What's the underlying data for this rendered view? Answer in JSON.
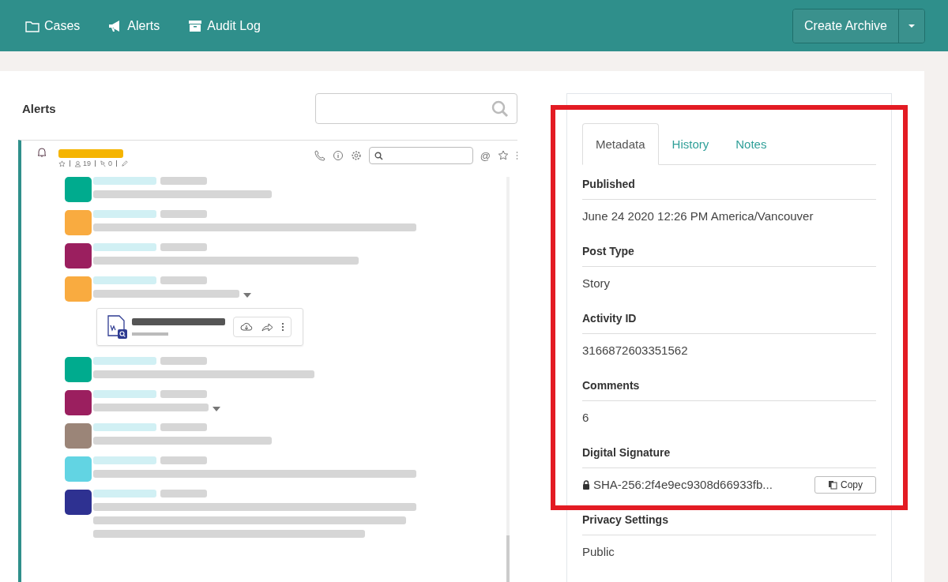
{
  "nav": {
    "items": [
      {
        "label": "Cases"
      },
      {
        "label": "Alerts"
      },
      {
        "label": "Audit Log"
      }
    ],
    "action": "Create Archive"
  },
  "alerts": {
    "title": "Alerts",
    "feed": {
      "members": "19",
      "pins": "0",
      "mention": "@",
      "messages": [
        {
          "color": "#00ab8e",
          "kind": "plain"
        },
        {
          "color": "#f9ab40",
          "kind": "plain"
        },
        {
          "color": "#9b1f5f",
          "kind": "plain"
        },
        {
          "color": "#f9ab40",
          "kind": "attachment"
        },
        {
          "color": "#00ab8e",
          "kind": "plain"
        },
        {
          "color": "#9b1f5f",
          "kind": "expandable"
        },
        {
          "color": "#9b8578",
          "kind": "plain"
        },
        {
          "color": "#62d4e3",
          "kind": "plain"
        },
        {
          "color": "#2e3191",
          "kind": "plain"
        }
      ]
    }
  },
  "details": {
    "highlighted": true,
    "tabs": [
      {
        "label": "Metadata",
        "selected": true
      },
      {
        "label": "History",
        "selected": false
      },
      {
        "label": "Notes",
        "selected": false
      }
    ],
    "fields": [
      {
        "label": "Published",
        "value": "June 24 2020 12:26 PM America/Vancouver",
        "kind": "text"
      },
      {
        "label": "Post Type",
        "value": "Story",
        "kind": "text"
      },
      {
        "label": "Activity ID",
        "value": "3166872603351562",
        "kind": "text"
      },
      {
        "label": "Comments",
        "value": "6",
        "kind": "text"
      },
      {
        "label": "Digital Signature",
        "value": "SHA-256:2f4e9ec9308d66933fb...",
        "kind": "signature",
        "button": "Copy"
      },
      {
        "label": "Privacy Settings",
        "value": "Public",
        "kind": "text"
      }
    ]
  }
}
